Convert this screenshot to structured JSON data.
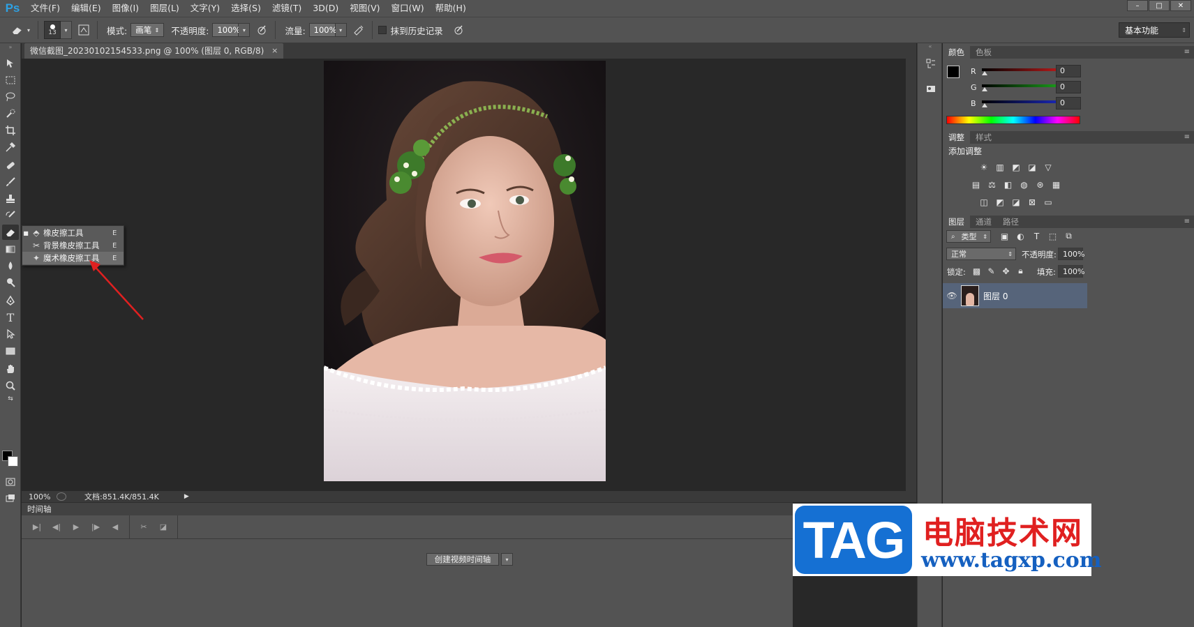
{
  "app": {
    "logo": "Ps"
  },
  "menu": [
    "文件(F)",
    "编辑(E)",
    "图像(I)",
    "图层(L)",
    "文字(Y)",
    "选择(S)",
    "滤镜(T)",
    "3D(D)",
    "视图(V)",
    "窗口(W)",
    "帮助(H)"
  ],
  "window_controls": {
    "minimize": "–",
    "restore": "□",
    "close": "✕"
  },
  "options": {
    "brush_size": "13",
    "mode_label": "模式:",
    "mode_value": "画笔",
    "opacity_label": "不透明度:",
    "opacity_value": "100%",
    "flow_label": "流量:",
    "flow_value": "100%",
    "erase_history_label": "抹到历史记录",
    "workspace": "基本功能"
  },
  "document": {
    "tab_title": "微信截图_20230102154533.png @ 100% (图层 0, RGB/8)",
    "close": "×"
  },
  "status": {
    "zoom": "100%",
    "doc_info": "文档:851.4K/851.4K"
  },
  "tool_flyout": [
    {
      "label": "橡皮擦工具",
      "key": "E",
      "icon": "eraser-icon"
    },
    {
      "label": "背景橡皮擦工具",
      "key": "E",
      "icon": "background-eraser-icon"
    },
    {
      "label": "魔术橡皮擦工具",
      "key": "E",
      "icon": "magic-eraser-icon"
    }
  ],
  "timeline": {
    "tab": "时间轴",
    "create_button": "创建视频时间轴"
  },
  "color_panel": {
    "tabs": [
      "颜色",
      "色板"
    ],
    "channels": [
      {
        "name": "R",
        "value": "0",
        "color": "#e02020"
      },
      {
        "name": "G",
        "value": "0",
        "color": "#20c020"
      },
      {
        "name": "B",
        "value": "0",
        "color": "#2030e0"
      }
    ]
  },
  "adjust_panel": {
    "tabs": [
      "调整",
      "样式"
    ],
    "title": "添加调整"
  },
  "layers_panel": {
    "tabs": [
      "图层",
      "通道",
      "路径"
    ],
    "filter": "类型",
    "blend_mode": "正常",
    "opacity_label": "不透明度:",
    "opacity_value": "100%",
    "lock_label": "锁定:",
    "fill_label": "填充:",
    "fill_value": "100%",
    "layers": [
      {
        "name": "图层 0"
      }
    ]
  },
  "watermark": {
    "logo": "TAG",
    "title": "电脑技术网",
    "url": "www.tagxp.com"
  }
}
